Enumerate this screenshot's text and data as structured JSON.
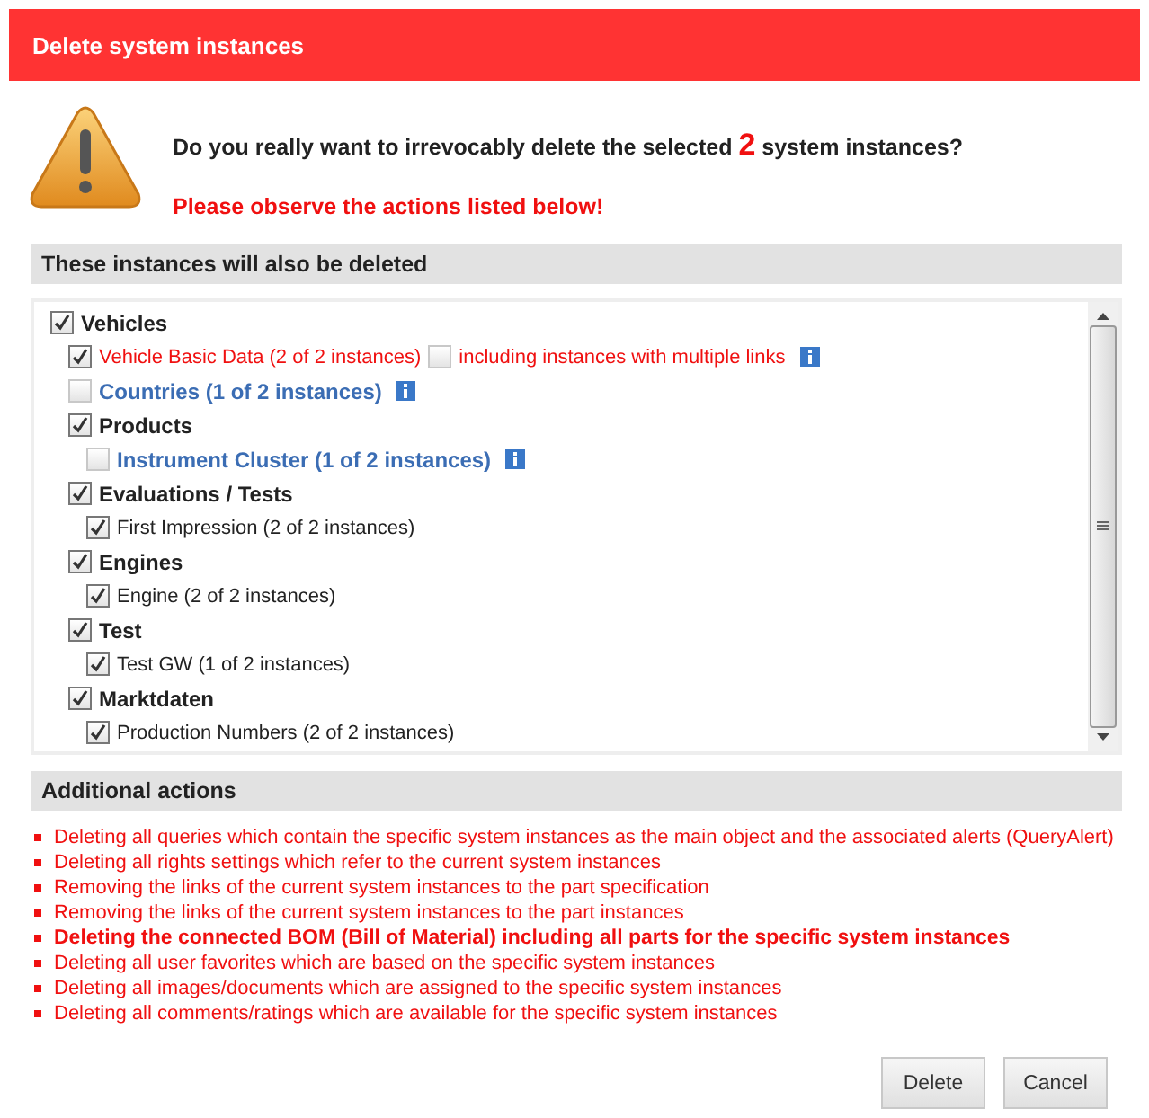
{
  "dialog": {
    "title": "Delete system instances"
  },
  "warning": {
    "question": "Do you really want to irrevocably delete the selected **2** system instances?",
    "notice": "Please observe the actions listed below!"
  },
  "instances": {
    "heading": "These instances will also be deleted",
    "tree": [
      {
        "label": "Vehicles",
        "kind": "group",
        "checked": true,
        "children": [
          {
            "label": "Vehicle Basic Data (2 of 2 instances)",
            "kind": "warning",
            "checked": true,
            "option": {
              "label": "including instances with multiple links",
              "checked": false
            },
            "info": true
          },
          {
            "label": "Countries (1 of 2 instances)",
            "kind": "link",
            "checked": false,
            "info": true
          },
          {
            "label": "Products",
            "kind": "group",
            "checked": true,
            "children": [
              {
                "label": "Instrument Cluster (1 of 2 instances)",
                "kind": "link",
                "checked": false,
                "info": true
              }
            ]
          },
          {
            "label": "Evaluations / Tests",
            "kind": "group",
            "checked": true,
            "children": [
              {
                "label": "First Impression (2 of 2 instances)",
                "kind": "item",
                "checked": true
              }
            ]
          },
          {
            "label": "Engines",
            "kind": "group",
            "checked": true,
            "children": [
              {
                "label": "Engine (2 of 2 instances)",
                "kind": "item",
                "checked": true
              }
            ]
          },
          {
            "label": "Test",
            "kind": "group",
            "checked": true,
            "children": [
              {
                "label": "Test GW (1 of 2 instances)",
                "kind": "item",
                "checked": true
              }
            ]
          },
          {
            "label": "Marktdaten",
            "kind": "group",
            "checked": true,
            "children": [
              {
                "label": "Production Numbers (2 of 2 instances)",
                "kind": "item",
                "checked": true
              }
            ]
          }
        ]
      }
    ]
  },
  "additional": {
    "heading": "Additional actions",
    "items": [
      {
        "text": "Deleting all queries which contain the specific system instances as the main object and the associated alerts (QueryAlert)",
        "emphasized": false
      },
      {
        "text": "Deleting all rights settings which refer to the current system instances",
        "emphasized": false
      },
      {
        "text": "Removing the links of the current system instances to the part specification",
        "emphasized": false
      },
      {
        "text": "Removing the links of the current system instances to the part instances",
        "emphasized": false
      },
      {
        "text": "Deleting the connected BOM (Bill of Material) including all parts for the specific system instances",
        "emphasized": true
      },
      {
        "text": "Deleting all user favorites which are based on the specific system instances",
        "emphasized": false
      },
      {
        "text": "Deleting all images/documents which are assigned to the specific system instances",
        "emphasized": false
      },
      {
        "text": "Deleting all comments/ratings which are available for the specific system instances",
        "emphasized": false
      }
    ]
  },
  "buttons": [
    "Delete",
    "Cancel"
  ]
}
